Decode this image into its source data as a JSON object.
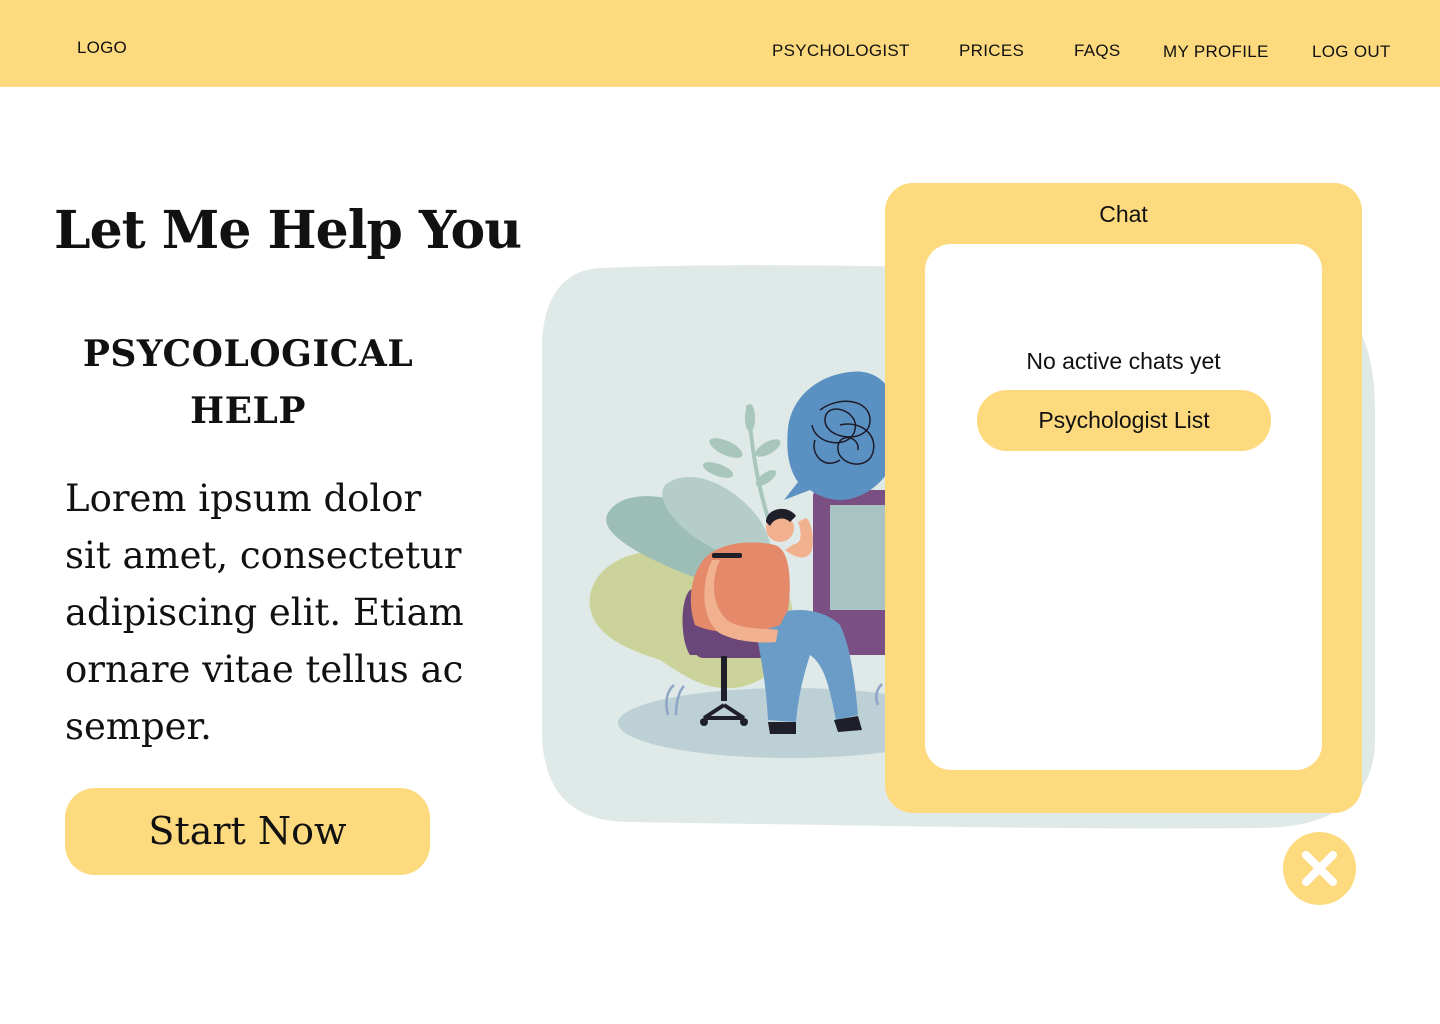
{
  "header": {
    "logo": "LOGO",
    "nav": [
      "PSYCHOLOGIST",
      "PRICES",
      "FAQS",
      "MY PROFILE",
      "LOG OUT"
    ]
  },
  "hero": {
    "title": "Let Me Help You",
    "subtitle_line1": "PSYCOLOGICAL",
    "subtitle_line2": "HELP",
    "body_line1": "Lorem ipsum dolor",
    "body_line2": "sit amet, consectetur",
    "body_line3": "adipiscing elit. Etiam",
    "body_line4": "ornare vitae tellus ac",
    "body_line5": "semper.",
    "cta_label": "Start Now"
  },
  "chat": {
    "title": "Chat",
    "empty_message": "No active chats yet",
    "list_button": "Psychologist List",
    "close_icon": "close-icon"
  },
  "colors": {
    "accent": "#FDDA7E",
    "blob": "#DFEAE8",
    "text": "#111111"
  }
}
